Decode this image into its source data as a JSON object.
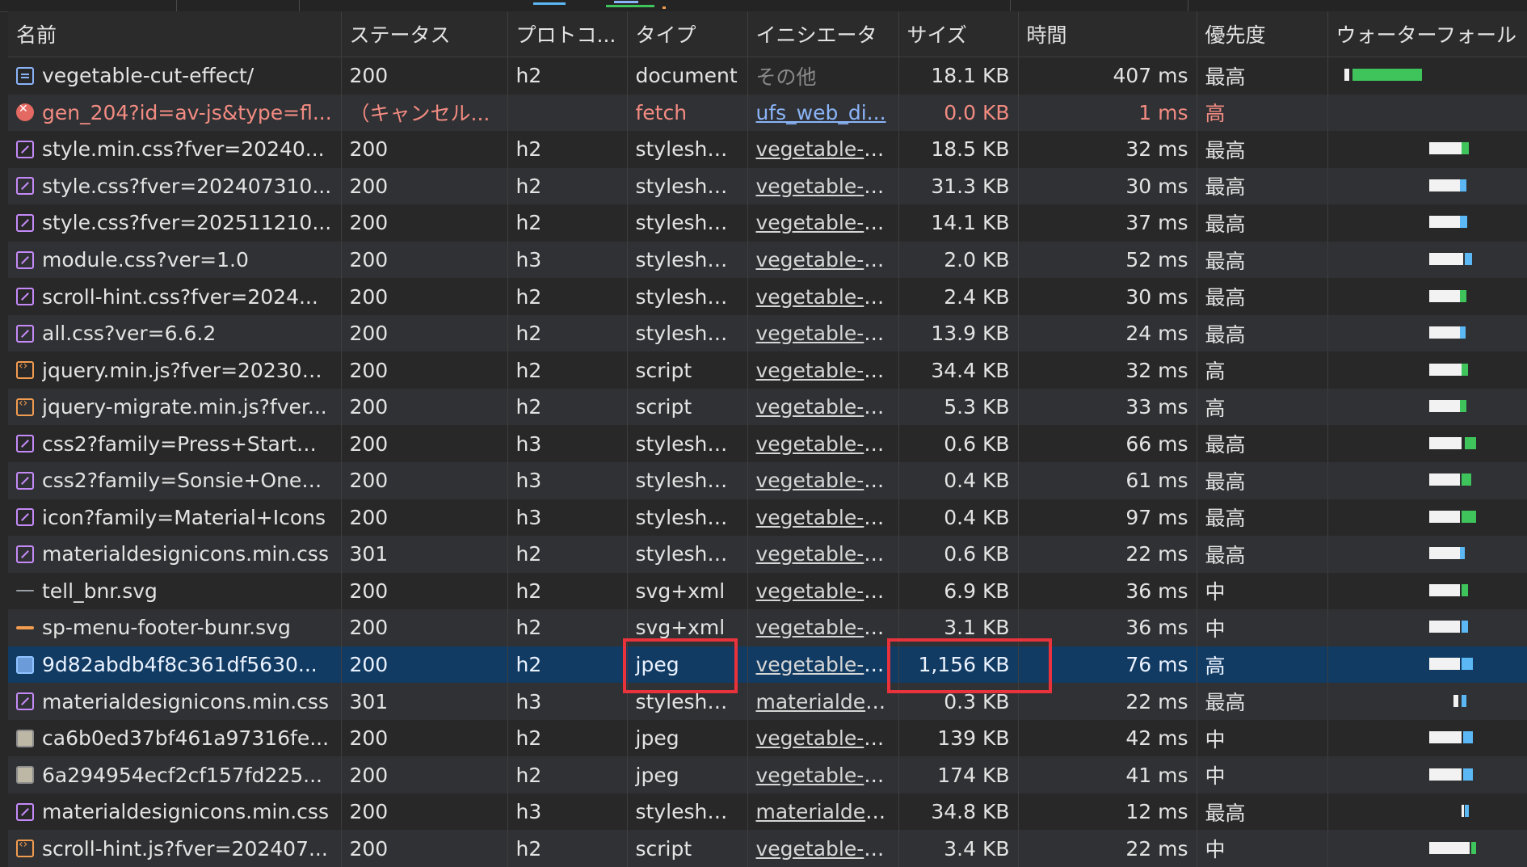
{
  "columns": {
    "name": "名前",
    "status": "ステータス",
    "protocol": "プロトコ...",
    "type": "タイプ",
    "initiator": "イニシエータ",
    "size": "サイズ",
    "time": "時間",
    "priority": "優先度",
    "waterfall": "ウォーターフォール"
  },
  "rows": [
    {
      "icon": "document-icon",
      "name": "vegetable-cut-effect/",
      "status": "200",
      "protocol": "h2",
      "type": "document",
      "initiator": "その他",
      "size": "18.1 KB",
      "time": "407 ms",
      "priority": "最高"
    },
    {
      "icon": "error-icon",
      "name": "gen_204?id=av-js&type=fl...",
      "status": "（キャンセル...",
      "protocol": "",
      "type": "fetch",
      "initiator": "ufs_web_di...",
      "size": "0.0 KB",
      "time": "1 ms",
      "priority": "高"
    },
    {
      "icon": "stylesheet-icon",
      "name": "style.min.css?fver=20240...",
      "status": "200",
      "protocol": "h2",
      "type": "stylesheet",
      "initiator": "vegetable-cut-",
      "size": "18.5 KB",
      "time": "32 ms",
      "priority": "最高"
    },
    {
      "icon": "stylesheet-icon",
      "name": "style.css?fver=202407310...",
      "status": "200",
      "protocol": "h2",
      "type": "stylesheet",
      "initiator": "vegetable-cut-",
      "size": "31.3 KB",
      "time": "30 ms",
      "priority": "最高"
    },
    {
      "icon": "stylesheet-icon",
      "name": "style.css?fver=202511210...",
      "status": "200",
      "protocol": "h2",
      "type": "stylesheet",
      "initiator": "vegetable-cut-",
      "size": "14.1 KB",
      "time": "37 ms",
      "priority": "最高"
    },
    {
      "icon": "stylesheet-icon",
      "name": "module.css?ver=1.0",
      "status": "200",
      "protocol": "h3",
      "type": "stylesheet",
      "initiator": "vegetable-cut-",
      "size": "2.0 KB",
      "time": "52 ms",
      "priority": "最高"
    },
    {
      "icon": "stylesheet-icon",
      "name": "scroll-hint.css?fver=2024...",
      "status": "200",
      "protocol": "h2",
      "type": "stylesheet",
      "initiator": "vegetable-cut-",
      "size": "2.4 KB",
      "time": "30 ms",
      "priority": "最高"
    },
    {
      "icon": "stylesheet-icon",
      "name": "all.css?ver=6.6.2",
      "status": "200",
      "protocol": "h2",
      "type": "stylesheet",
      "initiator": "vegetable-cut-",
      "size": "13.9 KB",
      "time": "24 ms",
      "priority": "最高"
    },
    {
      "icon": "script-icon",
      "name": "jquery.min.js?fver=202308...",
      "status": "200",
      "protocol": "h2",
      "type": "script",
      "initiator": "vegetable-cut-",
      "size": "34.4 KB",
      "time": "32 ms",
      "priority": "高"
    },
    {
      "icon": "script-icon",
      "name": "jquery-migrate.min.js?fver...",
      "status": "200",
      "protocol": "h2",
      "type": "script",
      "initiator": "vegetable-cut-",
      "size": "5.3 KB",
      "time": "33 ms",
      "priority": "高"
    },
    {
      "icon": "stylesheet-icon",
      "name": "css2?family=Press+Start+...",
      "status": "200",
      "protocol": "h3",
      "type": "stylesheet",
      "initiator": "vegetable-cut-",
      "size": "0.6 KB",
      "time": "66 ms",
      "priority": "最高"
    },
    {
      "icon": "stylesheet-icon",
      "name": "css2?family=Sonsie+One&...",
      "status": "200",
      "protocol": "h3",
      "type": "stylesheet",
      "initiator": "vegetable-cut-",
      "size": "0.4 KB",
      "time": "61 ms",
      "priority": "最高"
    },
    {
      "icon": "stylesheet-icon",
      "name": "icon?family=Material+Icons",
      "status": "200",
      "protocol": "h3",
      "type": "stylesheet",
      "initiator": "vegetable-cut-",
      "size": "0.4 KB",
      "time": "97 ms",
      "priority": "最高"
    },
    {
      "icon": "stylesheet-icon",
      "name": "materialdesignicons.min.css",
      "status": "301",
      "protocol": "h2",
      "type": "styleshe...",
      "initiator": "vegetable-cut-",
      "size": "0.6 KB",
      "time": "22 ms",
      "priority": "最高"
    },
    {
      "icon": "svg-thin-icon",
      "name": "tell_bnr.svg",
      "status": "200",
      "protocol": "h2",
      "type": "svg+xml",
      "initiator": "vegetable-cut-",
      "size": "6.9 KB",
      "time": "36 ms",
      "priority": "中"
    },
    {
      "icon": "svg-icon",
      "name": "sp-menu-footer-bunr.svg",
      "status": "200",
      "protocol": "h2",
      "type": "svg+xml",
      "initiator": "vegetable-cut-",
      "size": "3.1 KB",
      "time": "36 ms",
      "priority": "中"
    },
    {
      "icon": "image-icon",
      "name": "9d82abdb4f8c361df5630...",
      "status": "200",
      "protocol": "h2",
      "type": "jpeg",
      "initiator": "vegetable-cut-",
      "size": "1,156 KB",
      "time": "76 ms",
      "priority": "高",
      "selected": true
    },
    {
      "icon": "stylesheet-icon",
      "name": "materialdesignicons.min.css",
      "status": "301",
      "protocol": "h3",
      "type": "styleshe...",
      "initiator": "materialdesign",
      "size": "0.3 KB",
      "time": "22 ms",
      "priority": "最高"
    },
    {
      "icon": "image-icon",
      "name": "ca6b0ed37bf461a97316fe...",
      "status": "200",
      "protocol": "h2",
      "type": "jpeg",
      "initiator": "vegetable-cut-",
      "size": "139 KB",
      "time": "42 ms",
      "priority": "中"
    },
    {
      "icon": "image-icon",
      "name": "6a294954ecf2cf157fd225...",
      "status": "200",
      "protocol": "h2",
      "type": "jpeg",
      "initiator": "vegetable-cut-",
      "size": "174 KB",
      "time": "41 ms",
      "priority": "中"
    },
    {
      "icon": "stylesheet-icon",
      "name": "materialdesignicons.min.css",
      "status": "200",
      "protocol": "h3",
      "type": "stylesheet",
      "initiator": "materialdesign",
      "size": "34.8 KB",
      "time": "12 ms",
      "priority": "最高"
    },
    {
      "icon": "script-icon",
      "name": "scroll-hint.js?fver=202407...",
      "status": "200",
      "protocol": "h2",
      "type": "script",
      "initiator": "vegetable-cut-",
      "size": "3.4 KB",
      "time": "22 ms",
      "priority": "中"
    }
  ],
  "colors": {
    "selected_row": "#123b63",
    "highlight_box": "#e8323c",
    "error_text": "#f28b82"
  }
}
